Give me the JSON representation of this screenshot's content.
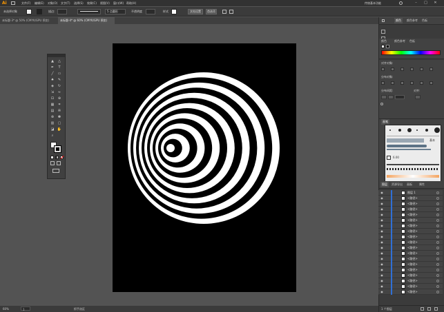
{
  "app": {
    "logo": "Ai"
  },
  "menu": [
    "文件(F)",
    "编辑(E)",
    "对象(O)",
    "文字(T)",
    "选择(S)",
    "效果(C)",
    "视图(V)",
    "窗口(W)",
    "帮助(H)"
  ],
  "workspace": "传统基本功能",
  "control_bar": {
    "selection_label": "未选择对象",
    "stroke_label": "描边:",
    "stroke_preset": "5 点圆形",
    "opacity_label": "不透明度",
    "style_label": "样式",
    "doc_setup": "文档设置",
    "prefs": "首选项"
  },
  "tabs": [
    {
      "label": "未标题-3* @ 50% (CMYK/GPU 预览)",
      "active": false
    },
    {
      "label": "未标题-4* @ 60% (CMYK/GPU 预览)",
      "active": true
    }
  ],
  "status": {
    "zoom": "60%",
    "page": "1",
    "tool": "抓手选区"
  },
  "right": {
    "top_tabs": [
      "颜色",
      "颜色参考",
      "色板"
    ],
    "color_panel_title": "颜色",
    "color_tabs": [
      "颜色参考",
      "色板"
    ],
    "align_title": "对齐对象:",
    "distribute_title": "分布对象:",
    "distribute_spacing": "分布间距:",
    "align_to": "对齐:",
    "brushes_title": "画笔",
    "brush_size": "基本",
    "brush_value": "6.00",
    "layers_tabs": [
      "图层",
      "资源导出",
      "画板",
      "属性"
    ],
    "layer_top": "图层 1",
    "path_name": "<路径>",
    "footer": "1 个图层"
  },
  "colors": {
    "accent": "#ff9a00",
    "artboard": "#000000",
    "stripe": "#ffffff"
  },
  "icons": [
    "selection-tool-icon",
    "direct-select-icon",
    "pen-icon",
    "type-icon",
    "line-icon",
    "rect-icon",
    "brush-icon",
    "pencil-icon",
    "eraser-icon",
    "rotate-icon",
    "scale-icon",
    "warp-icon",
    "free-transform-icon",
    "shape-builder-icon",
    "perspective-icon",
    "mesh-icon",
    "gradient-icon",
    "eyedropper-icon",
    "blend-icon",
    "symbol-icon",
    "graph-icon",
    "artboard-icon",
    "slice-icon",
    "hand-icon",
    "zoom-icon"
  ]
}
